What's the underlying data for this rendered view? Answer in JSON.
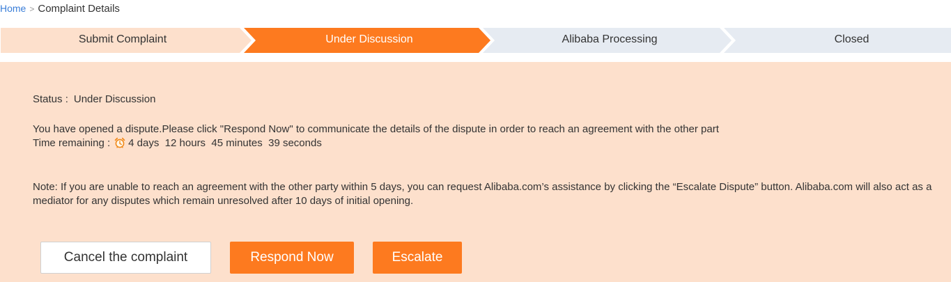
{
  "breadcrumb": {
    "home": "Home",
    "separator": ">",
    "current": "Complaint Details"
  },
  "steps": [
    {
      "label": "Submit Complaint",
      "state": "done"
    },
    {
      "label": "Under Discussion",
      "state": "active"
    },
    {
      "label": "Alibaba Processing",
      "state": "pending"
    },
    {
      "label": "Closed",
      "state": "pending"
    }
  ],
  "colors": {
    "done": "#fde0cc",
    "active": "#fd7a1f",
    "pending": "#e6ebf2",
    "panel": "#fde0cc",
    "link": "#3a7ed8"
  },
  "status": {
    "label": "Status :",
    "value": "Under Discussion"
  },
  "message": "You have opened a dispute.Please click \"Respond Now\" to communicate the details of the dispute in order to reach an agreement with the other part",
  "time": {
    "label": "Time remaining :",
    "icon": "alarm-clock-icon",
    "value": "4 days  12 hours  45 minutes  39 seconds"
  },
  "note": "Note: If you are unable to reach an agreement with the other party within 5 days, you can request Alibaba.com’s assistance by clicking the “Escalate Dispute” button. Alibaba.com will also act as a mediator for any disputes which remain unresolved after 10 days of initial opening.",
  "buttons": {
    "cancel": "Cancel the complaint",
    "respond": "Respond Now",
    "escalate": "Escalate"
  }
}
